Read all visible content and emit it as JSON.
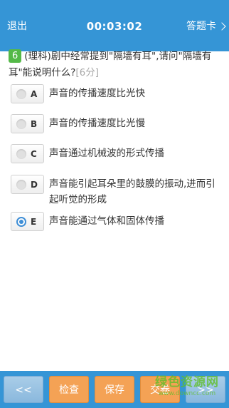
{
  "header": {
    "exit_label": "退出",
    "timer": "00:03:02",
    "answer_card_label": "答题卡"
  },
  "question": {
    "number": "6",
    "text": "(理科)剧中经常提到\"隔墙有耳\",请问\"隔墙有耳\"能说明什么?",
    "score": "[6分]"
  },
  "options": [
    {
      "letter": "A",
      "text": "声音的传播速度比光快",
      "selected": false
    },
    {
      "letter": "B",
      "text": "声音的传播速度比光慢",
      "selected": false
    },
    {
      "letter": "C",
      "text": "声音通过机械波的形式传播",
      "selected": false
    },
    {
      "letter": "D",
      "text": "声音能引起耳朵里的鼓膜的振动,进而引起听觉的形成",
      "selected": false
    },
    {
      "letter": "E",
      "text": "声音能通过气体和固体传播",
      "selected": true
    }
  ],
  "footer": {
    "prev_label": "<<",
    "check_label": "检查",
    "save_label": "保存",
    "submit_label": "交卷",
    "next_label": ">>"
  },
  "watermark": {
    "main": "绿色资源网",
    "sub": "www.downcc.com"
  },
  "colors": {
    "header_bg": "#3595d6",
    "question_number_bg": "#54b948",
    "button_orange": "#f4a255",
    "radio_selected": "#3e8ed6"
  }
}
